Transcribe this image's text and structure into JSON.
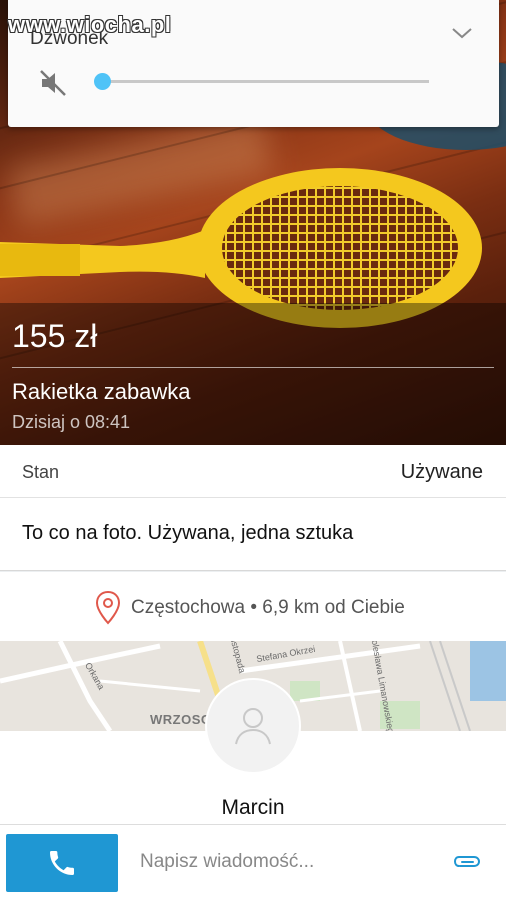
{
  "watermark": "www.wiocha.pl",
  "volume_panel": {
    "title": "Dzwonek",
    "level": 0.0,
    "icons": {
      "mute": "volume-off-icon",
      "expand": "chevron-down-icon"
    }
  },
  "listing": {
    "price": "155 zł",
    "title": "Rakietka zabawka",
    "date": "Dzisiaj o 08:41",
    "condition": {
      "label": "Stan",
      "value": "Używane"
    },
    "description": "To co na foto. Używana, jedna sztuka",
    "location": "Częstochowa • 6,9 km od Ciebie"
  },
  "map": {
    "labels": [
      "Listopada",
      "Stefana Okrzei",
      "Bolesława Limanowskiego",
      "Orkana",
      "WRZOSO"
    ]
  },
  "seller": {
    "name": "Marcin"
  },
  "bottom_bar": {
    "message_placeholder": "Napisz wiadomość...",
    "icons": {
      "call": "phone-icon",
      "attach": "paperclip-icon"
    }
  },
  "colors": {
    "accent": "#1f97d3",
    "slider": "#4fc3f7",
    "pin": "#e0584b"
  }
}
